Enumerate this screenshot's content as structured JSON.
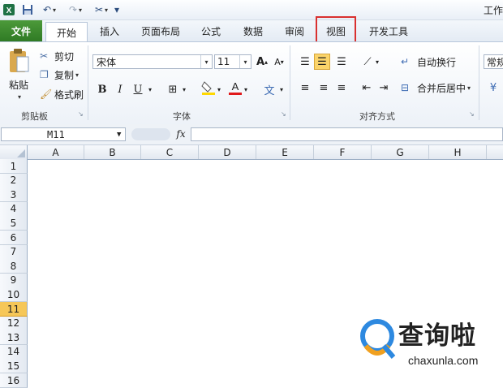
{
  "title_bar": {
    "title_fragment": "工作",
    "quick_access": [
      "save-icon",
      "undo-icon",
      "redo-icon",
      "customize-icon"
    ]
  },
  "tabs": [
    {
      "label": "文件"
    },
    {
      "label": "开始"
    },
    {
      "label": "插入"
    },
    {
      "label": "页面布局"
    },
    {
      "label": "公式"
    },
    {
      "label": "数据"
    },
    {
      "label": "审阅"
    },
    {
      "label": "视图"
    },
    {
      "label": "开发工具"
    }
  ],
  "ribbon": {
    "clipboard": {
      "paste": "粘贴",
      "cut": "剪切",
      "copy": "复制",
      "format_painter": "格式刷",
      "group": "剪贴板"
    },
    "font": {
      "font_name": "宋体",
      "font_size": "11",
      "group": "字体",
      "bold": "B",
      "italic": "I",
      "underline": "U"
    },
    "alignment": {
      "wrap_text": "自动换行",
      "merge_center": "合并后居中",
      "group": "对齐方式"
    },
    "number": {
      "format": "常规"
    }
  },
  "formula_bar": {
    "name_box": "M11",
    "fx": "fx",
    "formula": ""
  },
  "columns": [
    "A",
    "B",
    "C",
    "D",
    "E",
    "F",
    "G",
    "H"
  ],
  "rows": [
    "1",
    "2",
    "3",
    "4",
    "5",
    "6",
    "7",
    "8",
    "9",
    "10",
    "11",
    "12",
    "13",
    "14",
    "15",
    "16"
  ],
  "active_row": "11",
  "watermark": {
    "brand": "查询啦",
    "url": "chaxunla.com"
  },
  "colors": {
    "file_tab": "#2f7a24",
    "highlight": "#d9302f",
    "active_row": "#f6c758",
    "accent": "#2a4b7c"
  }
}
